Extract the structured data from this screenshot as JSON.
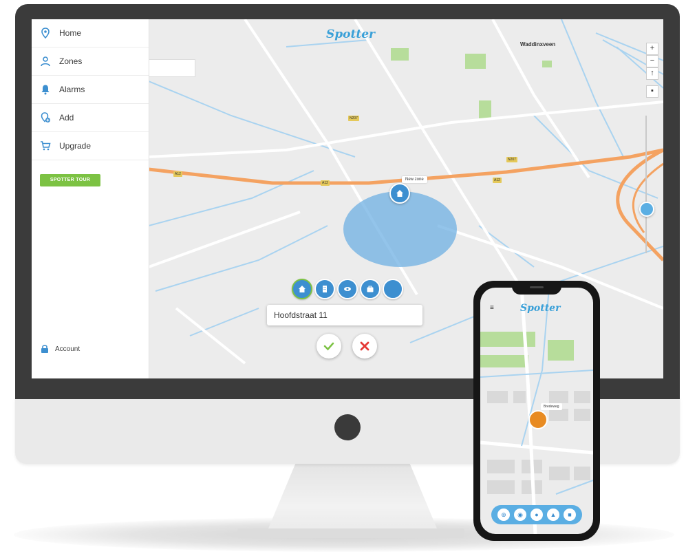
{
  "sidebar": {
    "items": [
      {
        "label": "Home",
        "icon": "location-pin-icon"
      },
      {
        "label": "Zones",
        "icon": "user-pin-icon"
      },
      {
        "label": "Alarms",
        "icon": "bell-icon"
      },
      {
        "label": "Add",
        "icon": "add-location-icon"
      },
      {
        "label": "Upgrade",
        "icon": "cart-icon"
      }
    ],
    "tour_button": "SPOTTER TOUR",
    "account": "Account"
  },
  "map": {
    "logo": "Spotter",
    "zone_label": "New zone",
    "address_value": "Hoofdstraat 11",
    "zone_types": [
      "home-icon",
      "building-icon",
      "eye-icon",
      "briefcase-icon",
      "circle-icon"
    ],
    "zoom_in": "+",
    "zoom_out": "−",
    "places": {
      "waddinxveen": "Waddinxveen",
      "bredeweg": "Bredeweg"
    }
  },
  "phone": {
    "logo": "Spotter",
    "pin_label": "Bredeweg"
  },
  "colors": {
    "accent_blue": "#3d8fd0",
    "brand_green": "#7cc243",
    "cancel_red": "#e53935",
    "highway_orange": "#f4a261"
  }
}
